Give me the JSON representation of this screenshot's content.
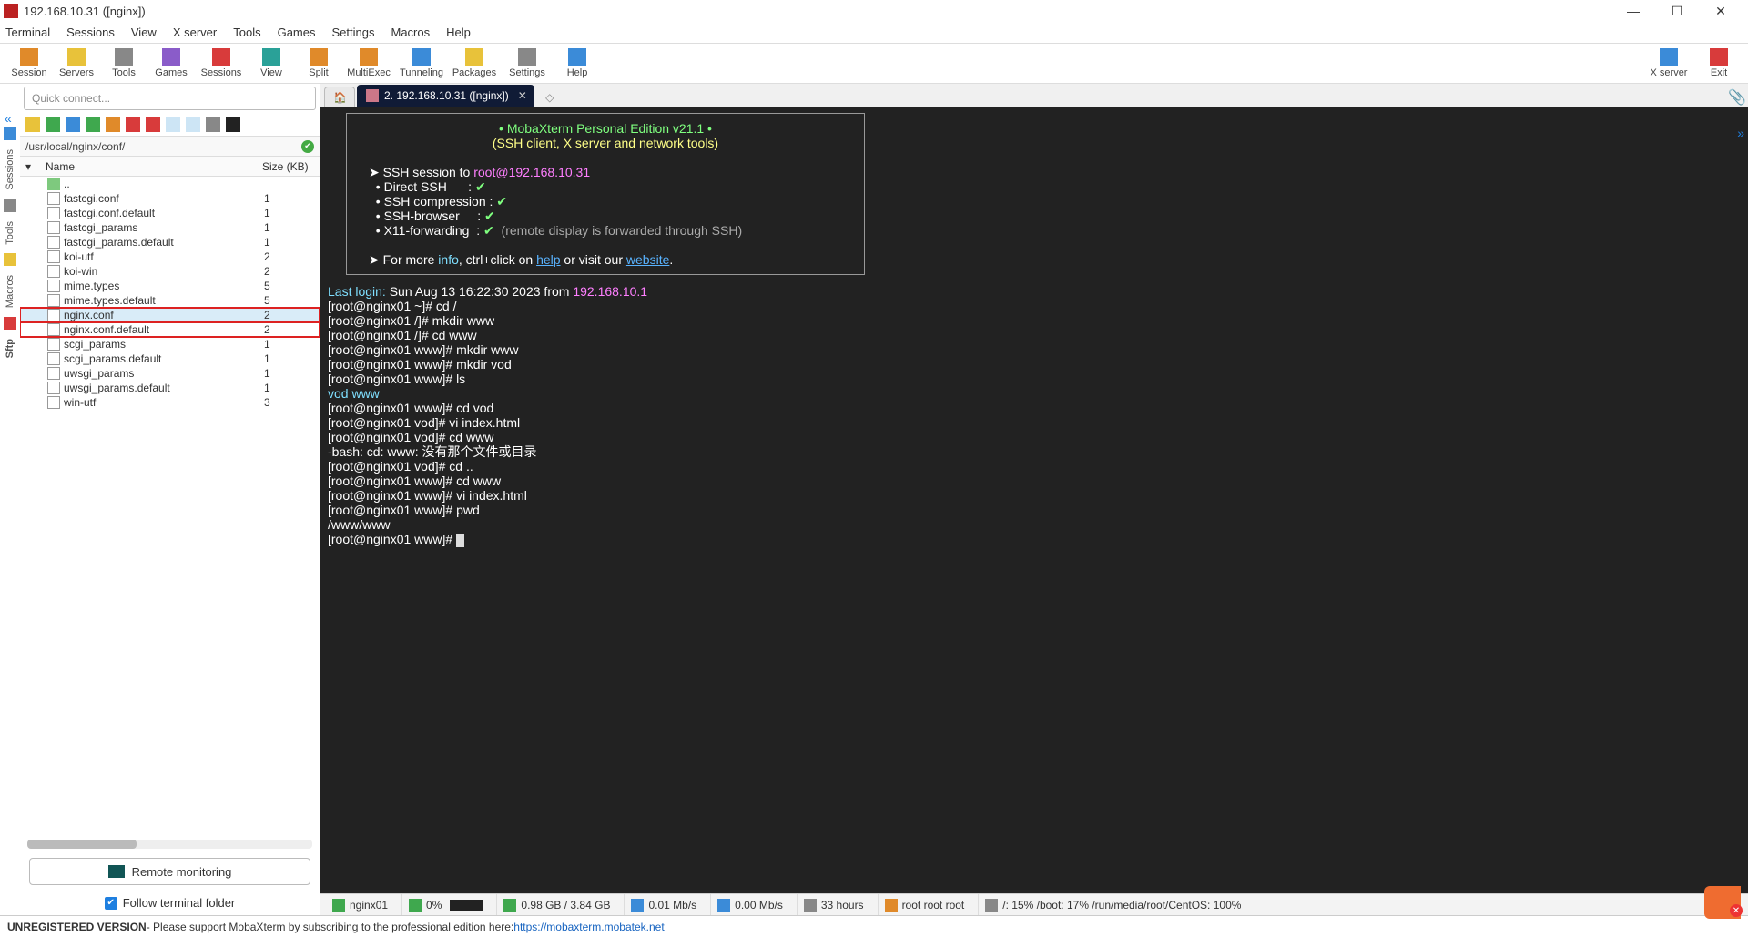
{
  "window": {
    "title": "192.168.10.31 ([nginx])",
    "minimize": "—",
    "maximize": "☐",
    "close": "✕"
  },
  "menubar": [
    "Terminal",
    "Sessions",
    "View",
    "X server",
    "Tools",
    "Games",
    "Settings",
    "Macros",
    "Help"
  ],
  "toolbar": {
    "items": [
      {
        "label": "Session",
        "color": "ic-orange"
      },
      {
        "label": "Servers",
        "color": "ic-yellow"
      },
      {
        "label": "Tools",
        "color": "ic-gray"
      },
      {
        "label": "Games",
        "color": "ic-purple"
      },
      {
        "label": "Sessions",
        "color": "ic-red"
      },
      {
        "label": "View",
        "color": "ic-teal"
      },
      {
        "label": "Split",
        "color": "ic-orange"
      },
      {
        "label": "MultiExec",
        "color": "ic-orange"
      },
      {
        "label": "Tunneling",
        "color": "ic-blue"
      },
      {
        "label": "Packages",
        "color": "ic-yellow"
      },
      {
        "label": "Settings",
        "color": "ic-gray"
      },
      {
        "label": "Help",
        "color": "ic-blue"
      }
    ],
    "right": [
      {
        "label": "X server",
        "color": "ic-blue"
      },
      {
        "label": "Exit",
        "color": "ic-red"
      }
    ]
  },
  "quick_connect_placeholder": "Quick connect...",
  "sidetabs": [
    "Sessions",
    "Tools",
    "Macros",
    "Sftp"
  ],
  "sftp_path": "/usr/local/nginx/conf/",
  "file_header": {
    "name": "Name",
    "size": "Size (KB)"
  },
  "files": [
    {
      "name": "..",
      "size": "",
      "folder": true
    },
    {
      "name": "fastcgi.conf",
      "size": "1"
    },
    {
      "name": "fastcgi.conf.default",
      "size": "1"
    },
    {
      "name": "fastcgi_params",
      "size": "1"
    },
    {
      "name": "fastcgi_params.default",
      "size": "1"
    },
    {
      "name": "koi-utf",
      "size": "2"
    },
    {
      "name": "koi-win",
      "size": "2"
    },
    {
      "name": "mime.types",
      "size": "5"
    },
    {
      "name": "mime.types.default",
      "size": "5"
    },
    {
      "name": "nginx.conf",
      "size": "2",
      "selected": true,
      "highlight": true
    },
    {
      "name": "nginx.conf.default",
      "size": "2",
      "highlight": true
    },
    {
      "name": "scgi_params",
      "size": "1"
    },
    {
      "name": "scgi_params.default",
      "size": "1"
    },
    {
      "name": "uwsgi_params",
      "size": "1"
    },
    {
      "name": "uwsgi_params.default",
      "size": "1"
    },
    {
      "name": "win-utf",
      "size": "3"
    }
  ],
  "remote_monitoring": "Remote monitoring",
  "follow_label": "Follow terminal folder",
  "tab": {
    "label": "2. 192.168.10.31 ([nginx])"
  },
  "banner": {
    "title": "• MobaXterm Personal Edition v21.1 •",
    "subtitle": "(SSH client, X server and network tools)",
    "ssh_prefix": "➤ SSH session to ",
    "ssh_target": "root@192.168.10.31",
    "lines": [
      {
        "label": "Direct SSH",
        "tick": "✔"
      },
      {
        "label": "SSH compression",
        "tick": "✔"
      },
      {
        "label": "SSH-browser",
        "tick": "✔"
      },
      {
        "label": "X11-forwarding",
        "tick": "✔",
        "extra": "(remote display is forwarded through SSH)"
      }
    ],
    "more_prefix": "➤ For more ",
    "info": "info",
    "more_mid": ", ctrl+click on ",
    "help": "help",
    "more_mid2": " or visit our ",
    "website": "website",
    "more_end": "."
  },
  "terminal_lines": [
    {
      "segments": [
        {
          "t": "Last login:",
          "c": "tc-cyan"
        },
        {
          "t": " Sun Aug 13 16:22:30 2023 from ",
          "c": "tc-white"
        },
        {
          "t": "192.168.10.1",
          "c": "tc-magenta"
        }
      ]
    },
    {
      "segments": [
        {
          "t": "[root@nginx01 ~]# ",
          "c": "tc-white"
        },
        {
          "t": "cd /",
          "c": "tc-white"
        }
      ]
    },
    {
      "segments": [
        {
          "t": "[root@nginx01 /]# ",
          "c": "tc-white"
        },
        {
          "t": "mkdir www",
          "c": "tc-white"
        }
      ]
    },
    {
      "segments": [
        {
          "t": "[root@nginx01 /]# ",
          "c": "tc-white"
        },
        {
          "t": "cd www",
          "c": "tc-white"
        }
      ]
    },
    {
      "segments": [
        {
          "t": "[root@nginx01 www]# ",
          "c": "tc-white"
        },
        {
          "t": "mkdir www",
          "c": "tc-white"
        }
      ]
    },
    {
      "segments": [
        {
          "t": "[root@nginx01 www]# ",
          "c": "tc-white"
        },
        {
          "t": "mkdir vod",
          "c": "tc-white"
        }
      ]
    },
    {
      "segments": [
        {
          "t": "[root@nginx01 www]# ",
          "c": "tc-white"
        },
        {
          "t": "ls",
          "c": "tc-white"
        }
      ]
    },
    {
      "segments": [
        {
          "t": "vod  www",
          "c": "tc-cyan"
        }
      ]
    },
    {
      "segments": [
        {
          "t": "[root@nginx01 www]# ",
          "c": "tc-white"
        },
        {
          "t": "cd vod",
          "c": "tc-white"
        }
      ]
    },
    {
      "segments": [
        {
          "t": "[root@nginx01 vod]# ",
          "c": "tc-white"
        },
        {
          "t": "vi index.html",
          "c": "tc-white"
        }
      ]
    },
    {
      "segments": [
        {
          "t": "[root@nginx01 vod]# ",
          "c": "tc-white"
        },
        {
          "t": "cd www",
          "c": "tc-white"
        }
      ]
    },
    {
      "segments": [
        {
          "t": "-bash: cd: www: 没有那个文件或目录",
          "c": "tc-white"
        }
      ]
    },
    {
      "segments": [
        {
          "t": "[root@nginx01 vod]# ",
          "c": "tc-white"
        },
        {
          "t": "cd ..",
          "c": "tc-white"
        }
      ]
    },
    {
      "segments": [
        {
          "t": "[root@nginx01 www]# ",
          "c": "tc-white"
        },
        {
          "t": "cd www",
          "c": "tc-white"
        }
      ]
    },
    {
      "segments": [
        {
          "t": "[root@nginx01 www]# ",
          "c": "tc-white"
        },
        {
          "t": "vi index.html",
          "c": "tc-white"
        }
      ]
    },
    {
      "segments": [
        {
          "t": "[root@nginx01 www]# ",
          "c": "tc-white"
        },
        {
          "t": "pwd",
          "c": "tc-white"
        }
      ]
    },
    {
      "segments": [
        {
          "t": "/www/www",
          "c": "tc-white"
        }
      ]
    },
    {
      "segments": [
        {
          "t": "[root@nginx01 www]# ",
          "c": "tc-white"
        }
      ],
      "cursor": true
    }
  ],
  "status": {
    "host": "nginx01",
    "cpu": "0%",
    "ram": "0.98 GB / 3.84 GB",
    "up": "0.01 Mb/s",
    "down": "0.00 Mb/s",
    "uptime": "33 hours",
    "users": "root  root  root",
    "disks": "/: 15%   /boot: 17%   /run/media/root/CentOS: 100%"
  },
  "registration": {
    "strong": "UNREGISTERED VERSION",
    "text": " -  Please support MobaXterm by subscribing to the professional edition here:  ",
    "url": "https://mobaxterm.mobatek.net"
  }
}
